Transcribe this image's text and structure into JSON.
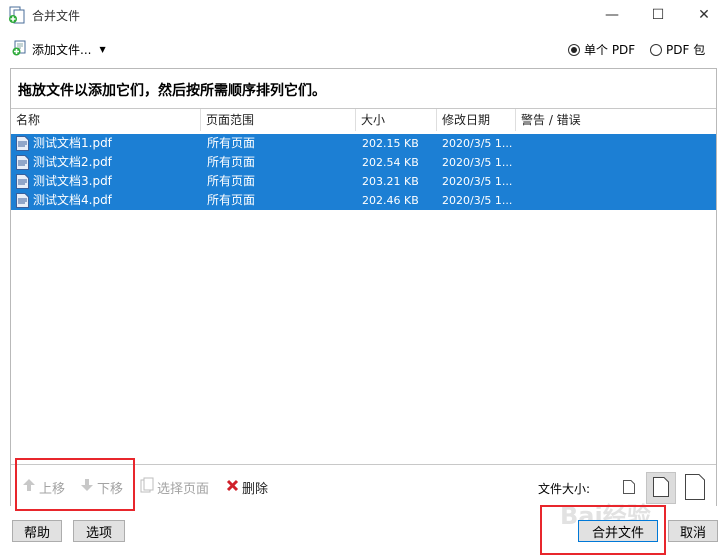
{
  "window": {
    "title": "合并文件",
    "minimize_glyph": "—",
    "maximize_glyph": "☐",
    "close_glyph": "✕"
  },
  "toolbar": {
    "add_files_label": "添加文件...",
    "radio_single_label": "单个 PDF",
    "radio_package_label": "PDF 包",
    "radio_selected": "single"
  },
  "instruction": "拖放文件以添加它们，然后按所需顺序排列它们。",
  "table": {
    "columns": [
      "名称",
      "页面范围",
      "大小",
      "修改日期",
      "警告 / 错误"
    ],
    "rows": [
      {
        "name": "测试文档1.pdf",
        "range": "所有页面",
        "size": "202.15 KB",
        "date": "2020/3/5 1...",
        "warning": ""
      },
      {
        "name": "测试文档2.pdf",
        "range": "所有页面",
        "size": "202.54 KB",
        "date": "2020/3/5 1...",
        "warning": ""
      },
      {
        "name": "测试文档3.pdf",
        "range": "所有页面",
        "size": "203.21 KB",
        "date": "2020/3/5 1...",
        "warning": ""
      },
      {
        "name": "测试文档4.pdf",
        "range": "所有页面",
        "size": "202.46 KB",
        "date": "2020/3/5 1...",
        "warning": ""
      }
    ],
    "selection_color": "#1c7fd4"
  },
  "bottom_toolbar": {
    "move_up_label": "上移",
    "move_down_label": "下移",
    "select_pages_label": "选择页面",
    "delete_label": "删除",
    "file_size_label": "文件大小:"
  },
  "footer": {
    "help_label": "帮助",
    "options_label": "选项",
    "merge_label": "合并文件",
    "cancel_label": "取消"
  },
  "watermark": "Bai经验",
  "colors": {
    "highlight_red": "#e8262c",
    "accent_blue": "#0078d7"
  },
  "icons": {
    "app": "merge-files-icon",
    "add": "add-file-icon",
    "file": "pdf-file-icon",
    "up": "arrow-up-icon",
    "down": "arrow-down-icon",
    "pages": "pages-icon",
    "delete": "delete-x-icon"
  }
}
